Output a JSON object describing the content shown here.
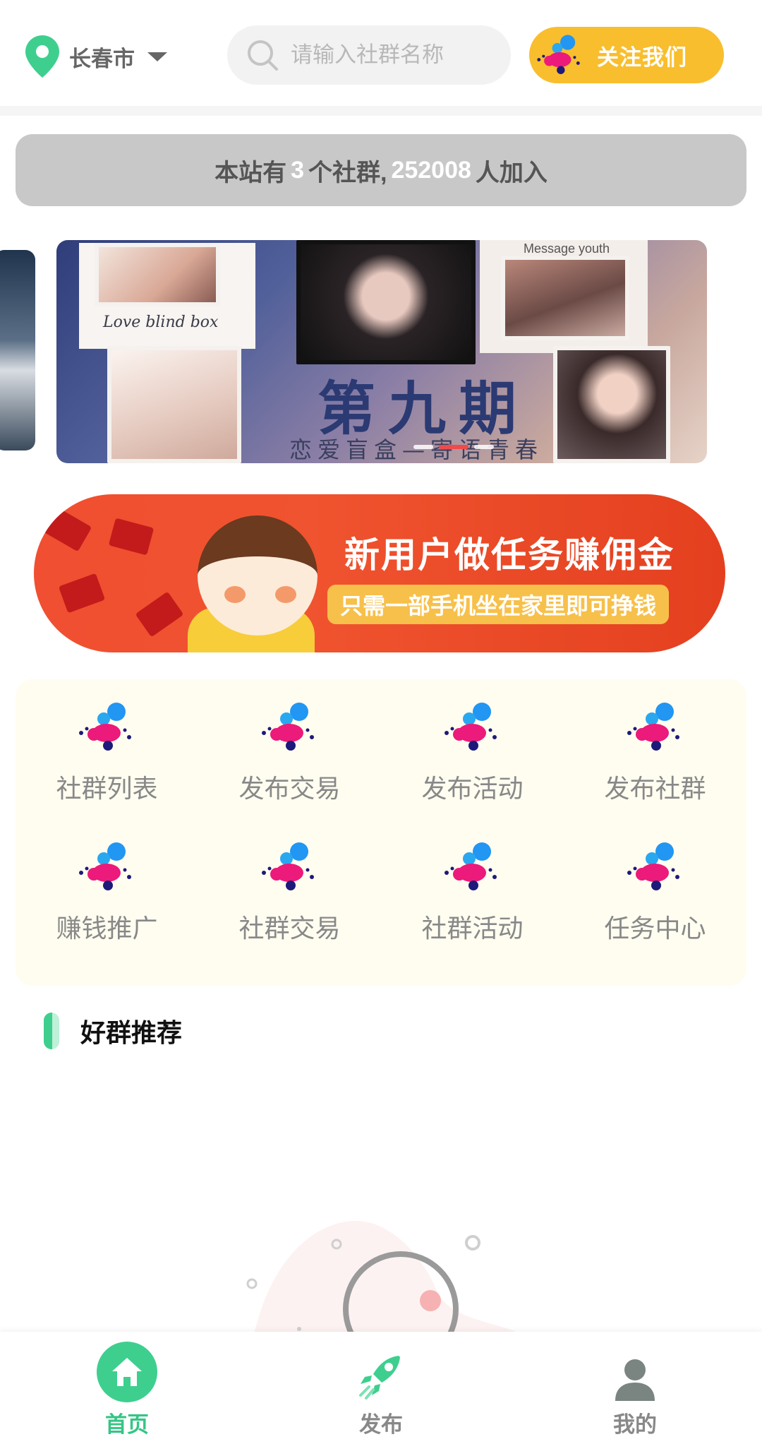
{
  "header": {
    "city": "长春市",
    "search_placeholder": "请输入社群名称",
    "follow_label": "关注我们"
  },
  "stats": {
    "prefix": "本站有",
    "group_count": "3",
    "middle": "个社群,",
    "member_count": "252008",
    "suffix": "人加入"
  },
  "carousel": {
    "love_text": "Love blind box",
    "message_text": "Message youth",
    "title": "第九期",
    "subtitle": "恋爱盲盒—寄语青春",
    "dot_count": 3,
    "active_index": 1
  },
  "promo": {
    "title": "新用户做任务赚佣金",
    "subtitle": "只需一部手机坐在家里即可挣钱"
  },
  "grid": {
    "items": [
      {
        "label": "社群列表",
        "icon": "bubbles-logo-icon"
      },
      {
        "label": "发布交易",
        "icon": "bubbles-logo-icon"
      },
      {
        "label": "发布活动",
        "icon": "bubbles-logo-icon"
      },
      {
        "label": "发布社群",
        "icon": "bubbles-logo-icon"
      },
      {
        "label": "赚钱推广",
        "icon": "bubbles-logo-icon"
      },
      {
        "label": "社群交易",
        "icon": "bubbles-logo-icon"
      },
      {
        "label": "社群活动",
        "icon": "bubbles-logo-icon"
      },
      {
        "label": "任务中心",
        "icon": "bubbles-logo-icon"
      }
    ]
  },
  "section": {
    "title": "好群推荐"
  },
  "tabbar": {
    "items": [
      {
        "label": "首页",
        "icon": "home-icon",
        "active": true
      },
      {
        "label": "发布",
        "icon": "rocket-icon",
        "active": false
      },
      {
        "label": "我的",
        "icon": "user-icon",
        "active": false
      }
    ]
  },
  "colors": {
    "brand_green": "#3ecf8e",
    "follow_yellow": "#f9be2d",
    "promo_red": "#f04f31",
    "grid_bg": "#fffdf0",
    "stats_bg": "#c8c8c8"
  }
}
